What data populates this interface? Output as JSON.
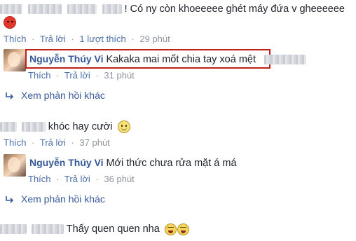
{
  "comment1": {
    "text": "! Có ny còn khoeeeee ghét máy đứa v gheeeeee",
    "actions": {
      "like": "Thích",
      "reply": "Trả lời",
      "likes_count": "1 lượt thích",
      "time": "29 phút"
    }
  },
  "reply1": {
    "author": "Nguyễn Thúy Vi",
    "text": "Kakaka mai mốt chia tay xoá mệt",
    "actions": {
      "like": "Thích",
      "reply": "Trả lời",
      "time": "31 phút"
    }
  },
  "more_replies_1": "Xem phản hồi khác",
  "comment2": {
    "text": "khóc hay cười",
    "actions": {
      "like": "Thích",
      "reply": "Trả lời",
      "time": "37 phút"
    }
  },
  "reply2": {
    "author": "Nguyễn Thúy Vi",
    "text": "Mới thức chưa rửa mặt á má",
    "actions": {
      "like": "Thích",
      "reply": "Trả lời",
      "time": "36 phút"
    }
  },
  "more_replies_2": "Xem phản hồi khác",
  "comment3": {
    "text": "Thấy quen quen nha"
  },
  "separator": "·"
}
